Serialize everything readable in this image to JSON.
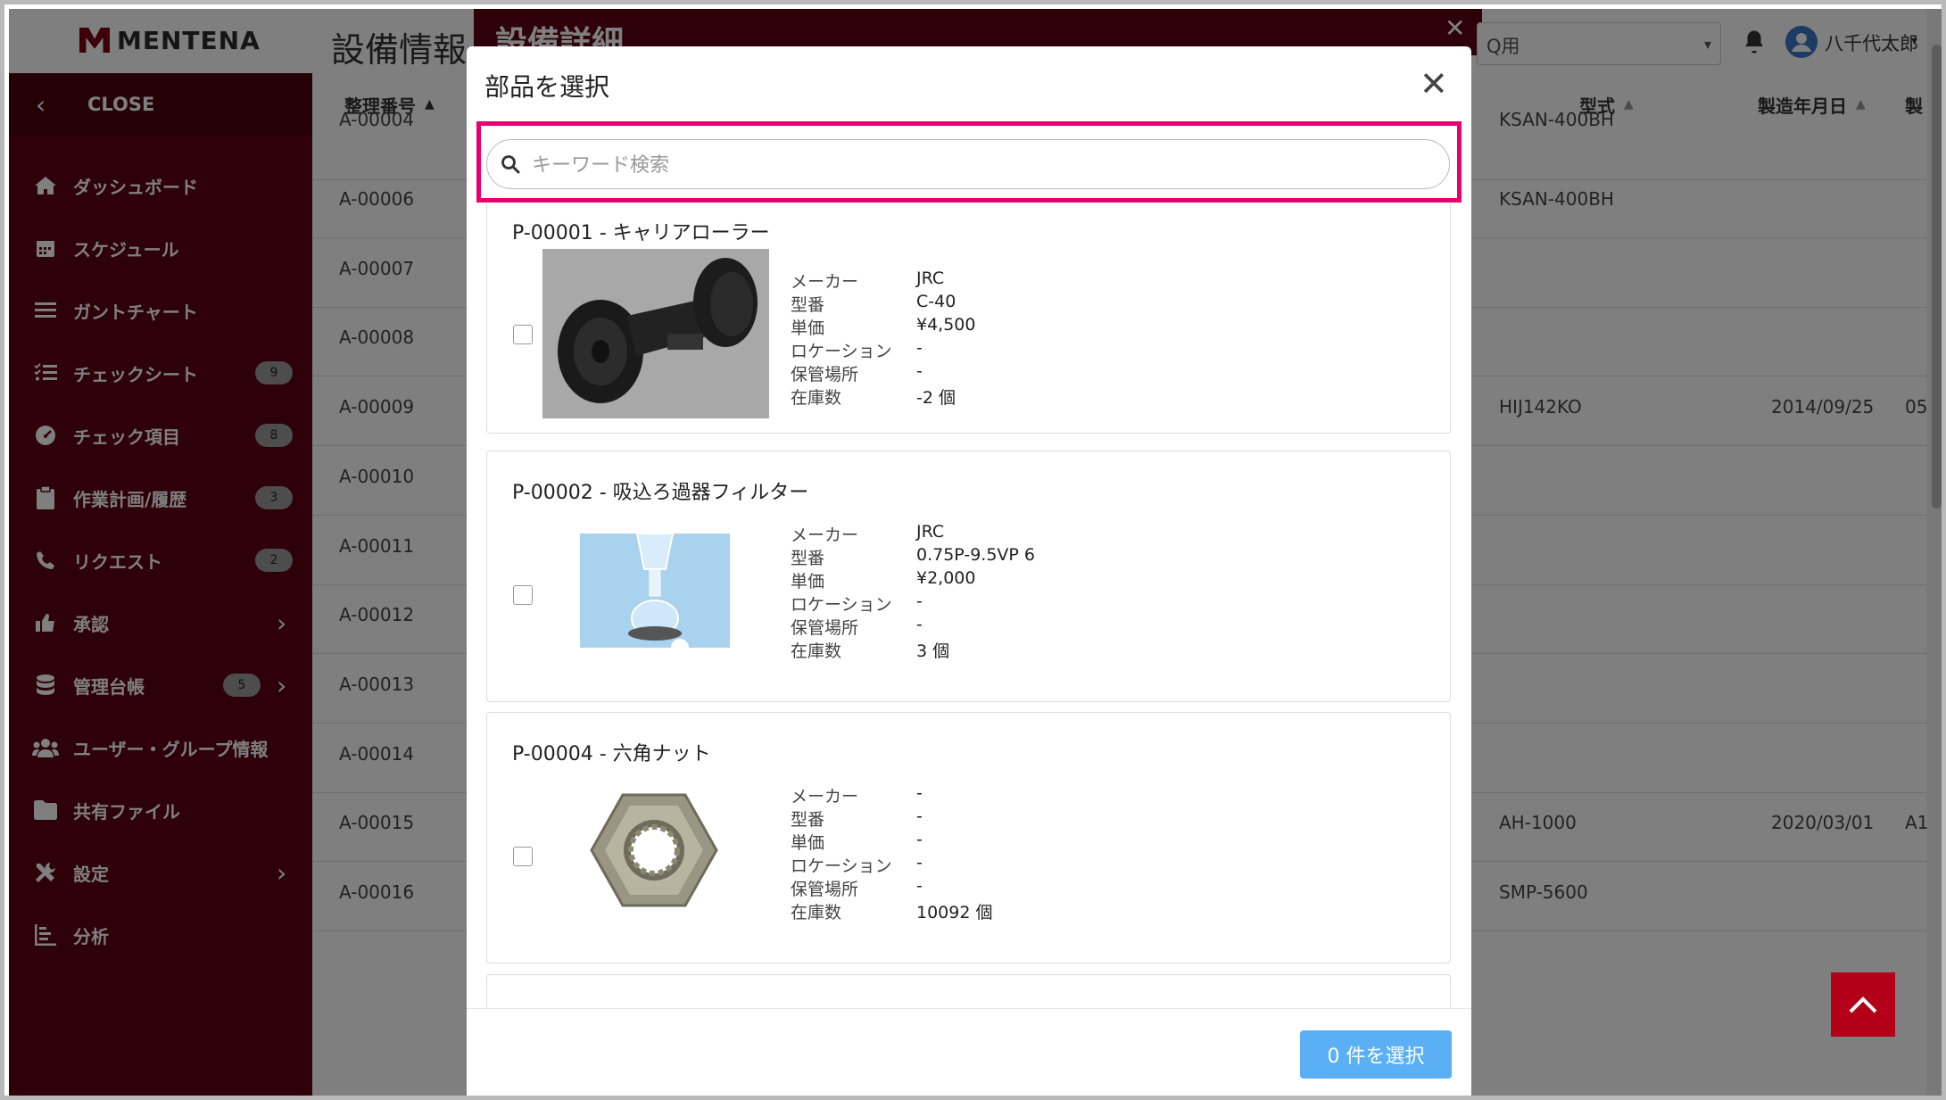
{
  "app": {
    "brand": "MENTENA",
    "bg_page_title": "設備情報",
    "detail_title": "設備詳細",
    "org_selector": "Q用",
    "user_name": "八千代太郎"
  },
  "sidebar": {
    "close_label": "CLOSE",
    "items": [
      {
        "label": "ダッシュボード",
        "icon": "home-icon",
        "badge": ""
      },
      {
        "label": "スケジュール",
        "icon": "calendar-icon",
        "badge": ""
      },
      {
        "label": "ガントチャート",
        "icon": "bars-icon",
        "badge": ""
      },
      {
        "label": "チェックシート",
        "icon": "checklist-icon",
        "badge": "9"
      },
      {
        "label": "チェック項目",
        "icon": "gauge-icon",
        "badge": "8"
      },
      {
        "label": "作業計画/履歴",
        "icon": "clipboard-icon",
        "badge": "3"
      },
      {
        "label": "リクエスト",
        "icon": "phone-icon",
        "badge": "2"
      },
      {
        "label": "承認",
        "icon": "thumbs-up-icon",
        "badge": ""
      },
      {
        "label": "管理台帳",
        "icon": "database-icon",
        "badge": "5"
      },
      {
        "label": "ユーザー・グループ情報",
        "icon": "users-icon",
        "badge": ""
      },
      {
        "label": "共有ファイル",
        "icon": "folder-icon",
        "badge": ""
      },
      {
        "label": "設定",
        "icon": "tools-icon",
        "badge": ""
      },
      {
        "label": "分析",
        "icon": "chart-icon",
        "badge": ""
      }
    ]
  },
  "table": {
    "headers": {
      "number": "整理番号",
      "model": "型式",
      "mfg_date": "製造年月日",
      "extra": "製"
    },
    "rows": [
      {
        "number": "A-00004",
        "model": "KSAN-400BH",
        "date": "",
        "extra": ""
      },
      {
        "number": "A-00006",
        "model": "KSAN-400BH",
        "date": "",
        "extra": ""
      },
      {
        "number": "A-00007",
        "model": "",
        "date": "",
        "extra": ""
      },
      {
        "number": "A-00008",
        "model": "",
        "date": "",
        "extra": ""
      },
      {
        "number": "A-00009",
        "model": "HIJ142KO",
        "date": "2014/09/25",
        "extra": "05"
      },
      {
        "number": "A-00010",
        "model": "",
        "date": "",
        "extra": ""
      },
      {
        "number": "A-00011",
        "model": "",
        "date": "",
        "extra": ""
      },
      {
        "number": "A-00012",
        "model": "",
        "date": "",
        "extra": ""
      },
      {
        "number": "A-00013",
        "model": "",
        "date": "",
        "extra": ""
      },
      {
        "number": "A-00014",
        "model": "",
        "date": "",
        "extra": ""
      },
      {
        "number": "A-00015",
        "model": "AH-1000",
        "date": "2020/03/01",
        "extra": "A1"
      },
      {
        "number": "A-00016",
        "model": "SMP-5600",
        "date": "",
        "extra": ""
      }
    ]
  },
  "modal": {
    "title": "部品を選択",
    "search": {
      "placeholder": "キーワード検索",
      "value": ""
    },
    "field_labels": {
      "maker": "メーカー",
      "model": "型番",
      "price": "単価",
      "location": "ロケーション",
      "storage": "保管場所",
      "stock": "在庫数"
    },
    "parts": [
      {
        "title": "P-00001 - キャリアローラー",
        "maker": "JRC",
        "model": "C-40",
        "price": "¥4,500",
        "location": "-",
        "storage": "-",
        "stock": "-2 個",
        "checked": false
      },
      {
        "title": "P-00002 - 吸込ろ過器フィルター",
        "maker": "JRC",
        "model": "0.75P-9.5VP 6",
        "price": "¥2,000",
        "location": "-",
        "storage": "-",
        "stock": "3 個",
        "checked": false
      },
      {
        "title": "P-00004 - 六角ナット",
        "maker": "-",
        "model": "-",
        "price": "-",
        "location": "-",
        "storage": "-",
        "stock": "10092 個",
        "checked": false
      }
    ],
    "footer_button": "0 件を選択"
  },
  "colors": {
    "sidebar": "#5c0012",
    "highlight": "#e8006f",
    "primary_button": "#5aaff5"
  }
}
